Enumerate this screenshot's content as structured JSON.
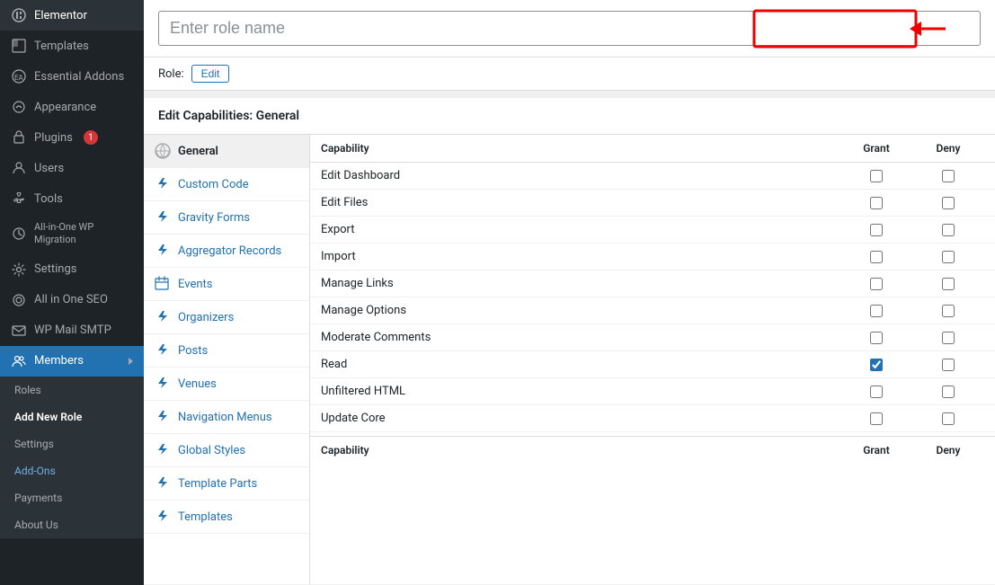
{
  "sidebar": {
    "items": [
      {
        "id": "elementor",
        "label": "Elementor",
        "icon": "E",
        "badge": null
      },
      {
        "id": "templates",
        "label": "Templates",
        "icon": "⬜",
        "badge": null
      },
      {
        "id": "essential-addons",
        "label": "Essential Addons",
        "icon": "EA",
        "badge": null
      },
      {
        "id": "appearance",
        "label": "Appearance",
        "icon": "🎨",
        "badge": null
      },
      {
        "id": "plugins",
        "label": "Plugins",
        "icon": "🔌",
        "badge": "1"
      },
      {
        "id": "users",
        "label": "Users",
        "icon": "👤",
        "badge": null
      },
      {
        "id": "tools",
        "label": "Tools",
        "icon": "🔧",
        "badge": null
      },
      {
        "id": "allinone",
        "label": "All-in-One WP Migration",
        "icon": "↑",
        "badge": null
      },
      {
        "id": "settings",
        "label": "Settings",
        "icon": "⚙",
        "badge": null
      },
      {
        "id": "allinseo",
        "label": "All in One SEO",
        "icon": "◎",
        "badge": null
      },
      {
        "id": "wpmail",
        "label": "WP Mail SMTP",
        "icon": "✉",
        "badge": null
      },
      {
        "id": "members",
        "label": "Members",
        "icon": "👥",
        "badge": null
      }
    ],
    "submenu": {
      "visible": true,
      "items": [
        {
          "id": "roles",
          "label": "Roles",
          "active": false
        },
        {
          "id": "add-new-role",
          "label": "Add New Role",
          "active": true
        },
        {
          "id": "settings-sub",
          "label": "Settings",
          "active": false
        },
        {
          "id": "add-ons",
          "label": "Add-Ons",
          "active": false,
          "linkColor": true
        },
        {
          "id": "payments",
          "label": "Payments",
          "active": false
        },
        {
          "id": "about-us",
          "label": "About Us",
          "active": false
        }
      ]
    }
  },
  "roleInput": {
    "placeholder": "Enter role name",
    "roleLabel": "Role:",
    "editButtonLabel": "Edit"
  },
  "capabilities": {
    "header": "Edit Capabilities: General",
    "navItems": [
      {
        "id": "general",
        "label": "General",
        "icon": "wp",
        "active": true
      },
      {
        "id": "custom-code",
        "label": "Custom Code",
        "icon": "bolt"
      },
      {
        "id": "gravity-forms",
        "label": "Gravity Forms",
        "icon": "bolt"
      },
      {
        "id": "aggregator-records",
        "label": "Aggregator Records",
        "icon": "bolt"
      },
      {
        "id": "events",
        "label": "Events",
        "icon": "calendar"
      },
      {
        "id": "organizers",
        "label": "Organizers",
        "icon": "bolt"
      },
      {
        "id": "posts",
        "label": "Posts",
        "icon": "bolt"
      },
      {
        "id": "venues",
        "label": "Venues",
        "icon": "bolt"
      },
      {
        "id": "navigation-menus",
        "label": "Navigation Menus",
        "icon": "bolt"
      },
      {
        "id": "global-styles",
        "label": "Global Styles",
        "icon": "bolt"
      },
      {
        "id": "template-parts",
        "label": "Template Parts",
        "icon": "bolt"
      },
      {
        "id": "templates",
        "label": "Templates",
        "icon": "bolt"
      }
    ],
    "tableHeader": {
      "capability": "Capability",
      "grant": "Grant",
      "deny": "Deny"
    },
    "rows": [
      {
        "id": "edit-dashboard",
        "name": "Edit Dashboard",
        "grant": false,
        "deny": false
      },
      {
        "id": "edit-files",
        "name": "Edit Files",
        "grant": false,
        "deny": false
      },
      {
        "id": "export",
        "name": "Export",
        "grant": false,
        "deny": false
      },
      {
        "id": "import",
        "name": "Import",
        "grant": false,
        "deny": false
      },
      {
        "id": "manage-links",
        "name": "Manage Links",
        "grant": false,
        "deny": false
      },
      {
        "id": "manage-options",
        "name": "Manage Options",
        "grant": false,
        "deny": false
      },
      {
        "id": "moderate-comments",
        "name": "Moderate Comments",
        "grant": false,
        "deny": false
      },
      {
        "id": "read",
        "name": "Read",
        "grant": true,
        "deny": false
      },
      {
        "id": "unfiltered-html",
        "name": "Unfiltered HTML",
        "grant": false,
        "deny": false
      },
      {
        "id": "update-core",
        "name": "Update Core",
        "grant": false,
        "deny": false
      },
      {
        "id": "capability-footer",
        "name": "Capability",
        "grant": false,
        "deny": false
      }
    ],
    "tableFooter": {
      "capability": "Capability",
      "grant": "Grant",
      "deny": "Deny"
    }
  }
}
